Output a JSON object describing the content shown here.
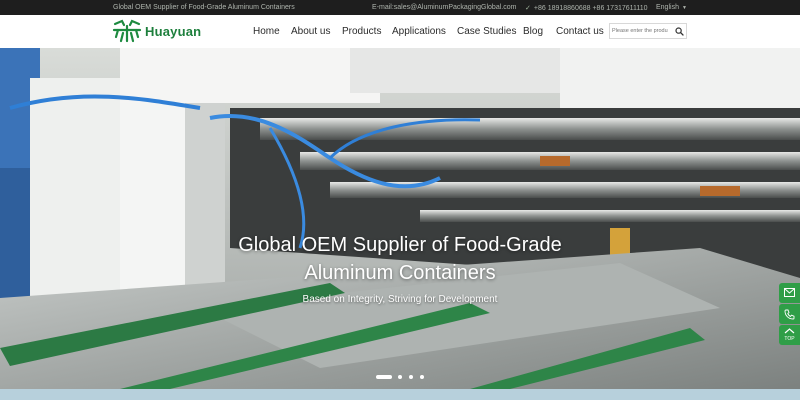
{
  "topbar": {
    "tagline": "Global OEM Supplier of Food-Grade Aluminum Containers",
    "email": "E-mail:sales@AluminumPackagingGlobal.com",
    "phone": "+86 18918860688 +86 17317611110",
    "language": "English"
  },
  "brand": {
    "name": "Huayuan",
    "color": "#1d7f3c"
  },
  "nav": {
    "items": [
      "Home",
      "About us",
      "Products",
      "Applications",
      "Case Studies",
      "Blog",
      "Contact us"
    ]
  },
  "search": {
    "placeholder": "Please enter the produ"
  },
  "hero": {
    "title_line1": "Global OEM Supplier of Food-Grade",
    "title_line2": "Aluminum Containers",
    "subtitle": "Based on Integrity, Striving for Development",
    "slides": 4,
    "active_slide": 1
  },
  "side_tools": {
    "top_label": "TOP",
    "accent": "#2f9e47",
    "icons": [
      "mail-icon",
      "phone-icon",
      "arrow-up-icon"
    ]
  },
  "colors": {
    "topbar_bg": "#1e1e1e",
    "green": "#1d7f3c",
    "conveyor_green": "#2c7a44"
  }
}
